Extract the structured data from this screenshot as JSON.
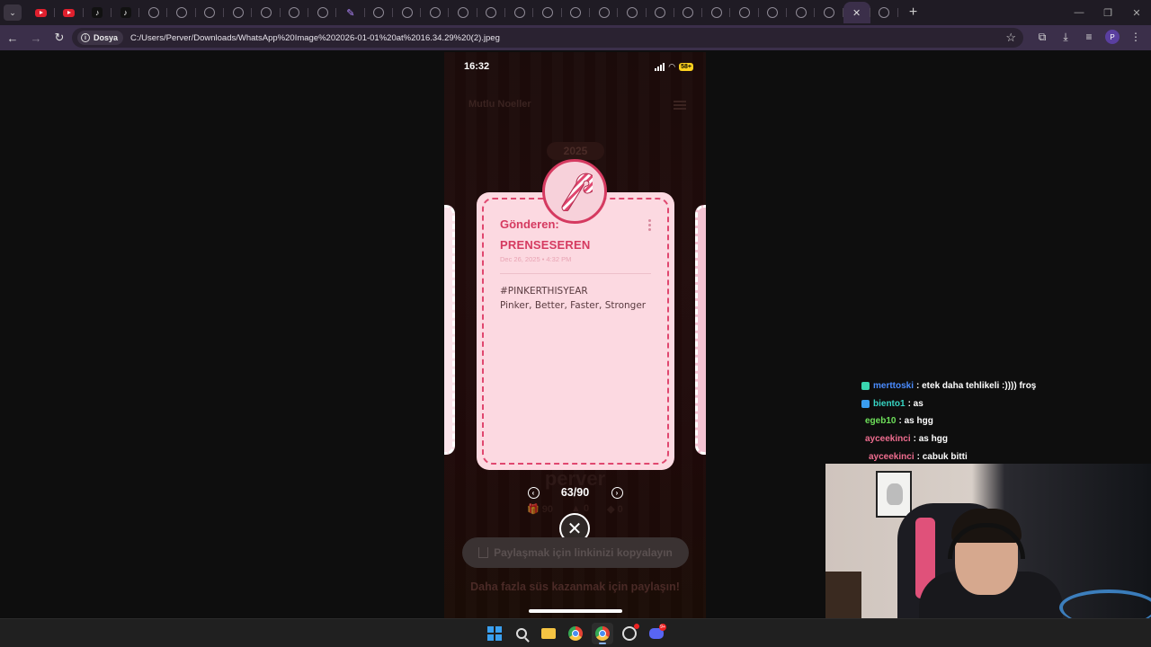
{
  "browser": {
    "tabs": [
      {
        "icon": "youtube-icon"
      },
      {
        "icon": "youtube-icon"
      },
      {
        "icon": "tiktok-icon"
      },
      {
        "icon": "tiktok-icon"
      },
      {
        "icon": "globe-icon"
      },
      {
        "icon": "globe-icon"
      },
      {
        "icon": "globe-icon"
      },
      {
        "icon": "globe-icon"
      },
      {
        "icon": "globe-icon"
      },
      {
        "icon": "globe-icon"
      },
      {
        "icon": "globe-icon"
      },
      {
        "icon": "pen-icon"
      },
      {
        "icon": "globe-icon"
      },
      {
        "icon": "globe-icon"
      },
      {
        "icon": "globe-icon"
      },
      {
        "icon": "globe-icon"
      },
      {
        "icon": "globe-icon"
      },
      {
        "icon": "globe-icon"
      },
      {
        "icon": "globe-icon"
      },
      {
        "icon": "globe-icon"
      },
      {
        "icon": "globe-icon"
      },
      {
        "icon": "globe-icon"
      },
      {
        "icon": "globe-icon"
      },
      {
        "icon": "globe-icon"
      },
      {
        "icon": "globe-icon"
      },
      {
        "icon": "globe-icon"
      },
      {
        "icon": "globe-icon"
      },
      {
        "icon": "globe-icon"
      },
      {
        "icon": "globe-icon"
      },
      {
        "icon": "close-icon",
        "active": true
      },
      {
        "icon": "globe-icon"
      }
    ],
    "address": {
      "chip_label": "Dosya",
      "url": "C:/Users/Perver/Downloads/WhatsApp%20Image%202026-01-01%20at%2016.34.29%20(2).jpeg"
    },
    "profile_initial": "P",
    "accent_color": "#3b2f4a"
  },
  "phone": {
    "status": {
      "time": "16:32",
      "battery": "58+"
    },
    "app_title": "Mutlu Noeller",
    "year": "2025",
    "card": {
      "badge_icon": "candy-cane-icon",
      "sender_label": "Gönderen:",
      "sender_name": "PRENSESEREN",
      "date": "Dec 26, 2025 • 4:32 PM",
      "message_line1": "#PINKERTHISYEAR",
      "message_line2": "Pinker, Better, Faster, Stronger",
      "accent_color": "#d53a60",
      "background_color": "#fcd9e1"
    },
    "profile_name": "perver",
    "stats": {
      "gifts": "90",
      "second": "0",
      "third": "0"
    },
    "pager": {
      "current": 63,
      "total": 90,
      "text": "63/90"
    },
    "share_button": "Paylaşmak için linkinizi kopyalayın",
    "share_hint": "Daha fazla süs kazanmak için paylaşın!"
  },
  "chat": {
    "messages": [
      {
        "user": "merttoski",
        "text": ": etek daha tehlikeli :)))) froş",
        "color": "#4a8cff",
        "badge_color": "#3ad6b0"
      },
      {
        "user": "biento1",
        "text": ": as",
        "color": "#37d6c4",
        "badge_color": "#3a9df0"
      },
      {
        "user": "egeb10",
        "text": ": as hgg",
        "color": "#6ee05a",
        "badge_color": ""
      },
      {
        "user": "ayceekinci",
        "text": ": as hgg",
        "color": "#ef6d8f",
        "badge_color": ""
      },
      {
        "user": "ayceekinci",
        "text": ": cabuk bitti",
        "color": "#ef6d8f",
        "badge_color": ""
      }
    ]
  },
  "taskbar": {
    "icons": [
      "windows-start-icon",
      "search-icon",
      "file-explorer-icon",
      "chrome-icon",
      "chrome-icon",
      "obs-icon",
      "discord-icon"
    ],
    "discord_badge": "9+"
  }
}
